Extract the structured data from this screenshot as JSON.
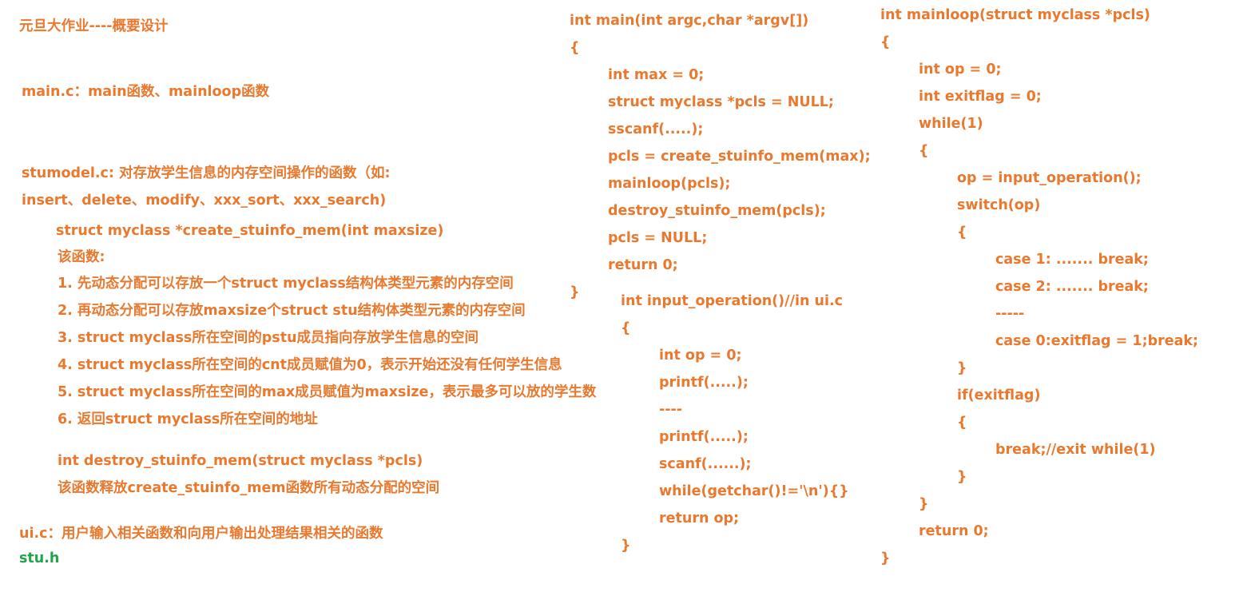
{
  "left": {
    "title": "元旦大作业----概要设计",
    "main_c": "main.c：main函数、mainloop函数",
    "stumodel_1": "stumodel.c: 对存放学生信息的内存空间操作的函数（如:",
    "stumodel_2": "insert、delete、modify、xxx_sort、xxx_search)",
    "create_sig": "struct myclass *create_stuinfo_mem(int maxsize)",
    "create_desc": "该函数:",
    "steps": [
      "1. 先动态分配可以存放一个struct myclass结构体类型元素的内存空间",
      "2. 再动态分配可以存放maxsize个struct stu结构体类型元素的内存空间",
      "3. struct myclass所在空间的pstu成员指向存放学生信息的空间",
      "4. struct myclass所在空间的cnt成员赋值为0，表示开始还没有任何学生信息",
      "5. struct myclass所在空间的max成员赋值为maxsize，表示最多可以放的学生数",
      "6. 返回struct myclass所在空间的地址"
    ],
    "destroy_sig": "int destroy_stuinfo_mem(struct myclass *pcls)",
    "destroy_desc": "该函数释放create_stuinfo_mem函数所有动态分配的空间",
    "ui_c": "ui.c：用户输入相关函数和向用户输出处理结果相关的函数",
    "stu_h": "stu.h"
  },
  "main_func": [
    "int main(int argc,char *argv[])",
    "{",
    "int max = 0;",
    "struct myclass *pcls = NULL;",
    "sscanf(.....);",
    "pcls = create_stuinfo_mem(max);",
    "mainloop(pcls);",
    "destroy_stuinfo_mem(pcls);",
    "pcls = NULL;",
    "return 0;",
    "}"
  ],
  "input_func": [
    "int input_operation()//in ui.c",
    "{",
    "int op = 0;",
    "printf(.....);",
    "----",
    "printf(.....);",
    "scanf(......);",
    "while(getchar()!='\\n'){}",
    "return op;",
    "}"
  ],
  "mainloop_func": [
    "int mainloop(struct myclass *pcls)",
    "{",
    "int op = 0;",
    "int exitflag = 0;",
    "while(1)",
    "{",
    "op = input_operation();",
    "switch(op)",
    "{",
    "case 1: ....... break;",
    "case 2: ....... break;",
    "-----",
    "case 0:exitflag = 1;break;",
    "}",
    "if(exitflag)",
    "{",
    "break;//exit while(1)",
    "}",
    "}",
    "return 0;",
    "}"
  ],
  "colors": {
    "text": "#e8792e",
    "green": "#23a34a"
  }
}
